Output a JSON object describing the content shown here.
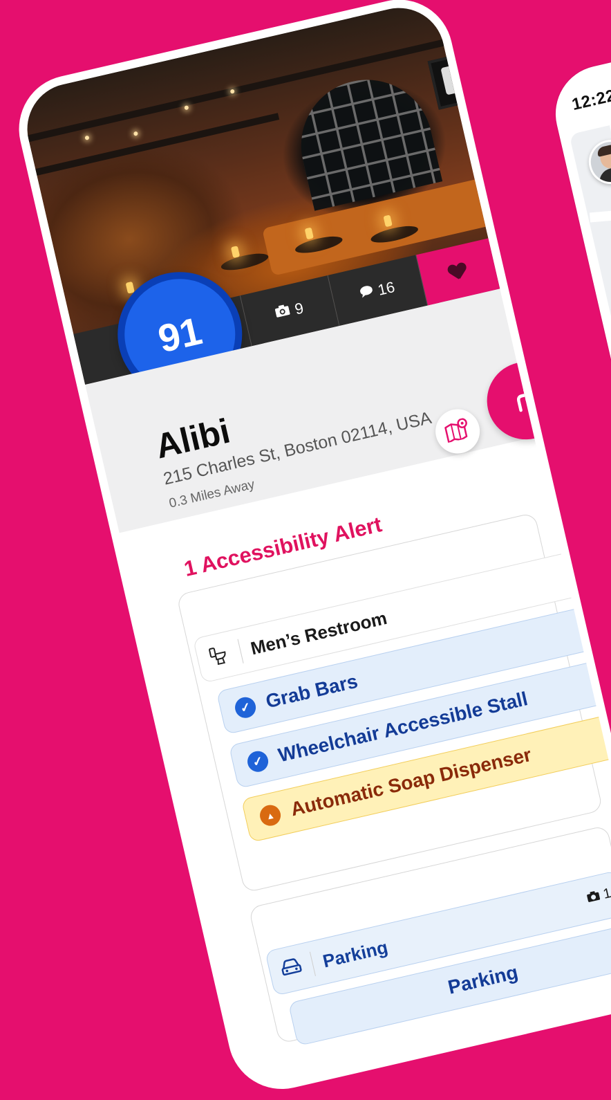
{
  "back_phone": {
    "time": "12:22"
  },
  "hero": {
    "score": "91",
    "photos_count": "9",
    "comments_count": "16"
  },
  "place": {
    "name": "Alibi",
    "address": "215 Charles St, Boston 02114, USA",
    "distance": "0.3 Miles Away"
  },
  "alerts": {
    "title": "1 Accessibility Alert",
    "plus": "+",
    "restroom": {
      "label": "Men’s Restroom",
      "items": [
        {
          "label": "Grab Bars",
          "status": "check"
        },
        {
          "label": "Wheelchair Accessible Stall",
          "status": "check"
        },
        {
          "label": "Automatic Soap Dispenser",
          "status": "warning"
        }
      ]
    },
    "parking": {
      "plus": "+",
      "label": "Parking",
      "photo_count": "1",
      "sub_label": "Parking"
    }
  },
  "icons": {
    "photo": "camera-icon",
    "comment": "speech-bubble-icon",
    "favorite": "heart-icon",
    "map": "map-pin-icon",
    "directions": "turn-right-arrow-icon",
    "restroom": "toilet-icon",
    "parking": "car-icon",
    "check": "checkmark-icon",
    "warning": "warning-triangle-icon"
  },
  "colors": {
    "brand": "#e50f6e",
    "score_blue": "#1d63ea",
    "check_blue": "#1f63d8",
    "warning_orange": "#d96a11",
    "warning_bg": "#fff1b8"
  }
}
